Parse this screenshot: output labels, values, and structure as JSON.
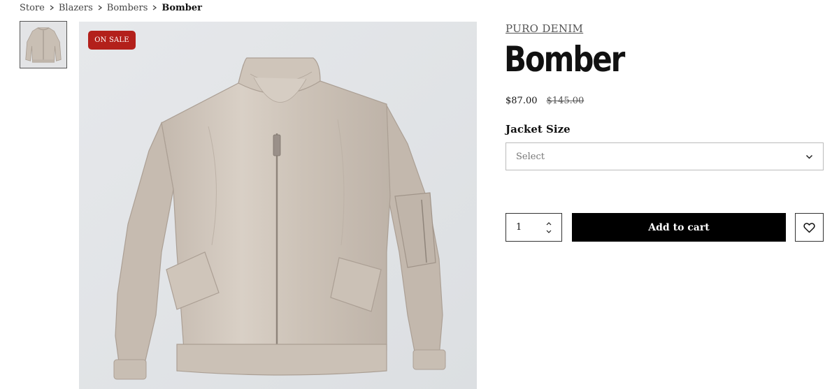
{
  "breadcrumb": {
    "items": [
      "Store",
      "Blazers",
      "Bombers",
      "Bomber"
    ]
  },
  "gallery": {
    "badge": "ON SALE",
    "thumbnail_icon": "jacket-thumbnail",
    "badge_color": "#b3201b"
  },
  "product": {
    "brand": "PURO DENIM",
    "title": "Bomber",
    "price": "$87.00",
    "original_price": "$145.00"
  },
  "size": {
    "label": "Jacket Size",
    "placeholder": "Select",
    "icon": "chevron-down-icon"
  },
  "cart": {
    "quantity": "1",
    "add_label": "Add to cart",
    "wishlist_icon": "heart-icon",
    "button_color": "#000000"
  }
}
